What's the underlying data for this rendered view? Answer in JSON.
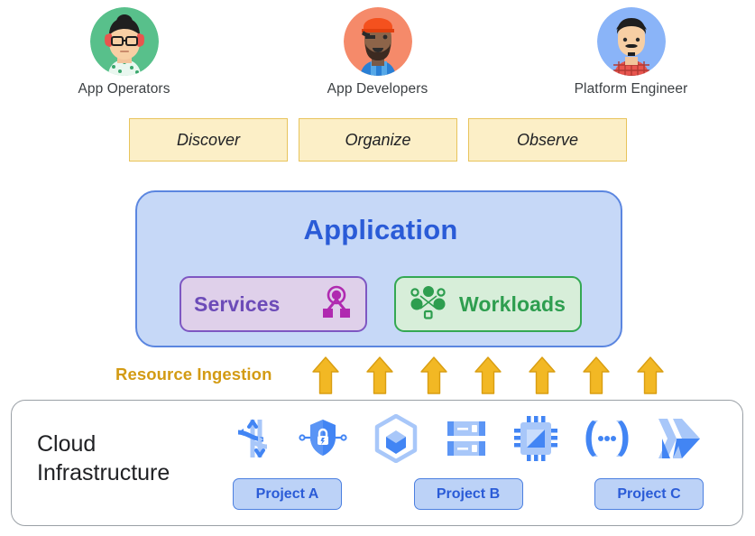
{
  "personas": [
    {
      "label": "App Operators",
      "avatar": "woman-glasses-headphones-avatar",
      "bg": "#58c08b",
      "accent": "#e8554e"
    },
    {
      "label": "App Developers",
      "avatar": "man-cap-eyepatch-beard-avatar",
      "bg": "#f58a6a",
      "accent": "#f4511e"
    },
    {
      "label": "Platform Engineer",
      "avatar": "man-mustache-plaid-avatar",
      "bg": "#8ab4f8",
      "accent": "#e8554e"
    }
  ],
  "capabilities": [
    {
      "label": "Discover"
    },
    {
      "label": "Organize"
    },
    {
      "label": "Observe"
    }
  ],
  "application": {
    "title": "Application",
    "panel_fill": "#c6d8f7",
    "panel_border": "#5b86e0",
    "title_color": "#2a5bd7",
    "children": [
      {
        "label": "Services",
        "icon": "services-mesh-icon",
        "color": "#6c4bb8",
        "fill": "#dfd0ea",
        "border": "#7e57c2"
      },
      {
        "label": "Workloads",
        "icon": "workloads-cluster-icon",
        "color": "#2e9e4f",
        "fill": "#d7eed9",
        "border": "#34a853"
      }
    ]
  },
  "ingestion": {
    "label": "Resource Ingestion",
    "color": "#d39b14",
    "arrow_count": 7,
    "arrow_icon": "up-arrow-icon"
  },
  "cloud_infrastructure": {
    "title_line1": "Cloud",
    "title_line2": "Infrastructure",
    "border": "#9aa0a6",
    "icons": [
      {
        "name": "traffic-director-icon"
      },
      {
        "name": "shield-lock-icon"
      },
      {
        "name": "container-registry-icon"
      },
      {
        "name": "server-rack-icon"
      },
      {
        "name": "cpu-chip-icon"
      },
      {
        "name": "code-brackets-icon"
      },
      {
        "name": "double-chevron-icon"
      }
    ],
    "projects": [
      {
        "label": "Project A"
      },
      {
        "label": "Project B"
      },
      {
        "label": "Project C"
      }
    ]
  }
}
